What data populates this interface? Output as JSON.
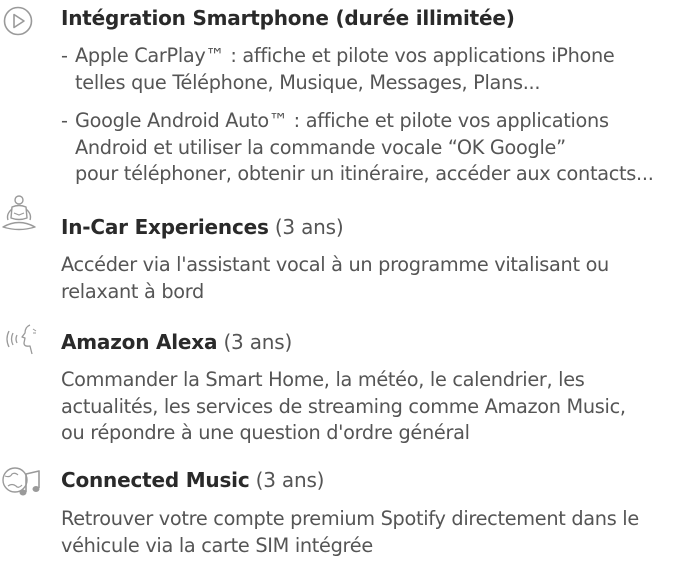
{
  "sections": [
    {
      "icon": "play-circle-icon",
      "title_bold": "Intégration Smartphone (durée illimitée)",
      "title_plain": "",
      "bullets": [
        {
          "dash": "-",
          "lines": [
            "Apple CarPlay™ : affiche et pilote vos applications iPhone",
            "telles que Téléphone, Musique, Messages, Plans..."
          ]
        },
        {
          "dash": "-",
          "lines": [
            "Google Android Auto™ : affiche et pilote vos applications",
            "Android et utiliser la commande vocale “OK Google”",
            "pour téléphoner, obtenir un itinéraire, accéder aux contacts..."
          ]
        }
      ]
    },
    {
      "icon": "meditation-person-icon",
      "title_bold": "In-Car Experiences",
      "title_plain": " (3 ans)",
      "lines": [
        "Accéder via l'assistant vocal à un programme vitalisant ou",
        "relaxant à bord"
      ]
    },
    {
      "icon": "voice-assistant-icon",
      "title_bold": "Amazon Alexa",
      "title_plain": " (3 ans)",
      "lines": [
        "Commander la Smart Home, la météo, le calendrier, les",
        "actualités, les services de streaming comme Amazon Music,",
        "ou répondre à une question d'ordre général"
      ]
    },
    {
      "icon": "globe-music-note-icon",
      "title_bold": "Connected Music",
      "title_plain": " (3 ans)",
      "lines": [
        "Retrouver votre compte premium Spotify directement dans le",
        "véhicule via la carte SIM intégrée"
      ]
    }
  ]
}
